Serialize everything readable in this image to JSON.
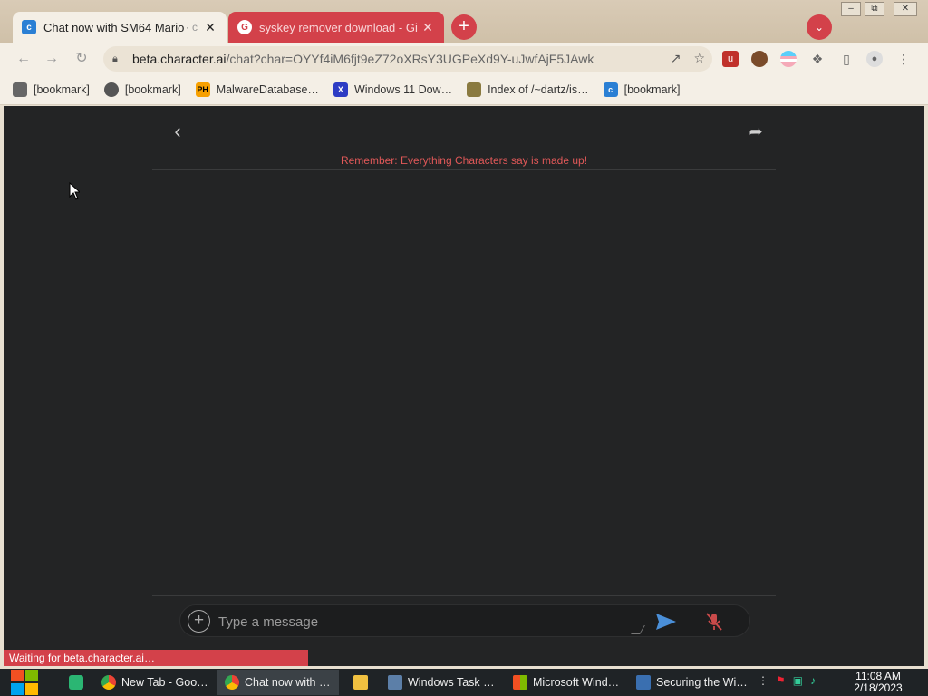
{
  "window": {
    "minimize": "–",
    "maximize": "⧉",
    "close": "✕"
  },
  "tabs": [
    {
      "title": "Chat now with SM64 Mario",
      "extra": "· c",
      "favicon": "character-ai-icon",
      "close": "✕"
    },
    {
      "title": "syskey remover download - Gi",
      "favicon": "google-icon",
      "close": "✕"
    }
  ],
  "tabstrip": {
    "new_tab": "+",
    "tab_search": "⌄"
  },
  "toolbar": {
    "back": "←",
    "forward": "→",
    "reload": "↻",
    "url_domain": "beta.character.ai",
    "url_path": "/chat?char=OYYf4iM6fjt9eZ72oXRsY3UGPeXd9Y-uJwfAjF5JAwk"
  },
  "bookmarks": [
    {
      "label": "[bookmark]",
      "icon": "bookmark-favicon-1"
    },
    {
      "label": "[bookmark]",
      "icon": "globe-icon"
    },
    {
      "label": "MalwareDatabase…",
      "icon": "ph-icon",
      "icon_text": "PH"
    },
    {
      "label": "Windows 11 Dow…",
      "icon": "x-icon",
      "icon_text": "X"
    },
    {
      "label": "Index of /~dartz/is…",
      "icon": "folder-figure-icon"
    },
    {
      "label": "[bookmark]",
      "icon": "character-ai-icon"
    }
  ],
  "page": {
    "disclaimer": "Remember: Everything Characters say is made up!",
    "composer_placeholder": "Type a message",
    "status": "Waiting for beta.character.ai…"
  },
  "taskbar": {
    "items": [
      {
        "label": "New Tab - Goo…",
        "icon": "chrome-icon"
      },
      {
        "label": "Chat now with …",
        "icon": "chrome-icon"
      },
      {
        "label": "",
        "icon": "folder-icon"
      },
      {
        "label": "Windows Task …",
        "icon": "task-manager-icon"
      },
      {
        "label": "Microsoft Wind…",
        "icon": "windows-update-icon"
      },
      {
        "label": "Securing the Wi…",
        "icon": "installer-icon"
      }
    ],
    "time": "11:08 AM",
    "date": "2/18/2023"
  },
  "colors": {
    "accent": "#d3414a",
    "page_bg": "#232425",
    "disclaimer": "#e05858",
    "send": "#4a8fd8"
  }
}
